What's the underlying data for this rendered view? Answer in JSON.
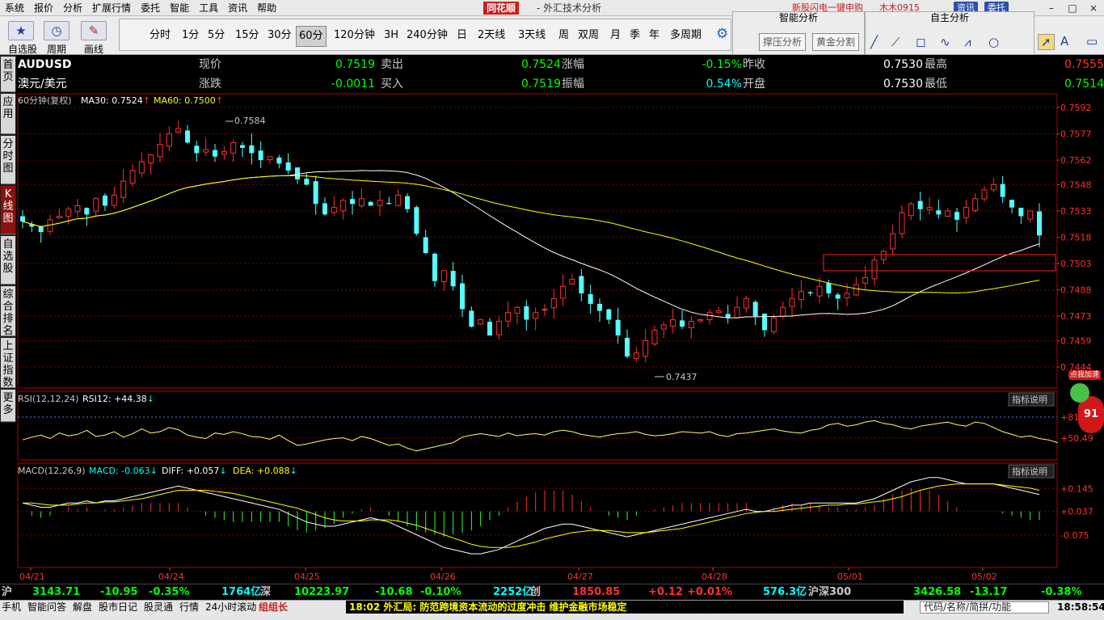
{
  "menu": {
    "items": [
      "系统",
      "报价",
      "分析",
      "扩展行情",
      "委托",
      "智能",
      "工具",
      "资讯",
      "帮助"
    ],
    "brand": "同花顺",
    "window_title": "- 外汇技术分析",
    "right_link1": "新股闪电一键申购",
    "right_link2": "木木0915",
    "btn_news": "资讯",
    "btn_trade": "委托",
    "win_min": "–",
    "win_max": "□",
    "win_close": "×"
  },
  "toolbar": {
    "zixuan": "自选股",
    "zhouqi": "周期",
    "huaxian": "画线",
    "periods": [
      "分时",
      "1分",
      "5分",
      "15分",
      "30分",
      "60分",
      "120分钟",
      "3H",
      "240分钟",
      "日",
      "2天线",
      "3天线",
      "周",
      "双周",
      "月",
      "季",
      "年",
      "多周期"
    ],
    "selected_period": "60分",
    "smart_title": "智能分析",
    "smart_btn1": "撑压分析",
    "smart_btn2": "黄金分割",
    "self_title": "自主分析"
  },
  "sidebar": [
    "首页",
    "应用",
    "分时图",
    "K线图",
    "自选股",
    "综合排名",
    "上证指数",
    "更多"
  ],
  "quote": {
    "symbol": "AUDUSD",
    "name": "澳元/美元",
    "fields": [
      {
        "label": "现价",
        "value": "0.7519",
        "color": "#00ff00"
      },
      {
        "label": "卖出",
        "value": "0.7524",
        "color": "#00ff00"
      },
      {
        "label": "涨幅",
        "value": "-0.15%",
        "color": "#00ff00"
      },
      {
        "label": "昨收",
        "value": "0.7530",
        "color": "#ffffff"
      },
      {
        "label": "最高",
        "value": "0.7555",
        "color": "#ff3030"
      },
      {
        "label": "涨跌",
        "value": "-0.0011",
        "color": "#00ff00"
      },
      {
        "label": "买入",
        "value": "0.7519",
        "color": "#00ff00"
      },
      {
        "label": "振幅",
        "value": "0.54%",
        "color": "#00ffff"
      },
      {
        "label": "开盘",
        "value": "0.7530",
        "color": "#ffffff"
      },
      {
        "label": "最低",
        "value": "0.7514",
        "color": "#00ff00"
      }
    ]
  },
  "chart_data": [
    {
      "type": "candlestick",
      "title": "60分钟(复权)",
      "indicators": [
        {
          "name": "MA30",
          "value": "0.7524",
          "arrow": "↑",
          "color": "#ffffff"
        },
        {
          "name": "MA60",
          "value": "0.7500",
          "arrow": "↑",
          "color": "#ffff00"
        }
      ],
      "ylim": [
        0.7443,
        0.7592
      ],
      "y_ticks": [
        "0.7592",
        "0.7577",
        "0.7562",
        "0.7548",
        "0.7533",
        "0.7518",
        "0.7503",
        "0.7488",
        "0.7473",
        "0.7459",
        "0.7444"
      ],
      "high_marker": "0.7584",
      "low_marker": "0.7437",
      "x_labels": [
        "04/21",
        "04/24",
        "04/25",
        "04/26",
        "04/27",
        "04/28",
        "05/01",
        "05/02"
      ],
      "close": [
        0.7527,
        0.7524,
        0.7521,
        0.7528,
        0.753,
        0.7534,
        0.7536,
        0.7531,
        0.754,
        0.7536,
        0.7542,
        0.755,
        0.7556,
        0.7561,
        0.7565,
        0.7571,
        0.7577,
        0.758,
        0.7572,
        0.7566,
        0.7568,
        0.7564,
        0.7567,
        0.7572,
        0.7569,
        0.7566,
        0.7562,
        0.7564,
        0.756,
        0.7556,
        0.7551,
        0.7548,
        0.7537,
        0.7531,
        0.7535,
        0.7539,
        0.7537,
        0.754,
        0.7536,
        0.7539,
        0.7537,
        0.7542,
        0.7534,
        0.752,
        0.7509,
        0.7493,
        0.7499,
        0.749,
        0.7477,
        0.7467,
        0.7471,
        0.7462,
        0.747,
        0.7475,
        0.7478,
        0.7471,
        0.7475,
        0.7477,
        0.7483,
        0.749,
        0.7494,
        0.7486,
        0.748,
        0.7476,
        0.7471,
        0.7462,
        0.745,
        0.7452,
        0.7459,
        0.7465,
        0.7468,
        0.7471,
        0.7467,
        0.747,
        0.7471,
        0.7475,
        0.7476,
        0.7472,
        0.7478,
        0.7483,
        0.7473,
        0.7465,
        0.7472,
        0.7478,
        0.7483,
        0.7487,
        0.7486,
        0.749,
        0.7486,
        0.7483,
        0.7486,
        0.7491,
        0.7495,
        0.7505,
        0.751,
        0.752,
        0.7532,
        0.7537,
        0.7534,
        0.7535,
        0.7531,
        0.7533,
        0.7528,
        0.7535,
        0.754,
        0.7545,
        0.7548,
        0.7541,
        0.7535,
        0.753,
        0.7533,
        0.7519
      ],
      "ma30_series_name": "MA30",
      "ma60_series_name": "MA60"
    },
    {
      "type": "line",
      "title": "RSI(12,12,24)",
      "label": "RSI12: +44.38",
      "arrow": "↓",
      "button": "指标说明",
      "ylim": [
        20,
        100
      ],
      "y_ticks": [
        "+81.12",
        "+50.49"
      ],
      "values": [
        48,
        52,
        55,
        50,
        58,
        54,
        56,
        62,
        53,
        55,
        60,
        52,
        57,
        64,
        58,
        60,
        66,
        63,
        55,
        52,
        50,
        58,
        56,
        60,
        57,
        53,
        52,
        49,
        55,
        47,
        40,
        42,
        45,
        48,
        50,
        51,
        47,
        53,
        50,
        45,
        40,
        42,
        36,
        32,
        35,
        38,
        41,
        44,
        52,
        55,
        57,
        55,
        53,
        58,
        54,
        56,
        57,
        55,
        60,
        62,
        60,
        56,
        54,
        52,
        55,
        57,
        58,
        60,
        56,
        54,
        55,
        57,
        60,
        59,
        58,
        60,
        55,
        53,
        57,
        58,
        60,
        62,
        64,
        61,
        59,
        58,
        62,
        64,
        70,
        72,
        68,
        70,
        74,
        76,
        72,
        70,
        66,
        64,
        68,
        70,
        72,
        74,
        70,
        68,
        74,
        72,
        66,
        60,
        56,
        52,
        54,
        50,
        48,
        44
      ]
    },
    {
      "type": "line",
      "title": "MACD(12,26,9)",
      "label_macd": "MACD: -0.063",
      "label_diff": "DIFF: +0.057",
      "label_dea": "DEA: +0.088",
      "arrow": "↓",
      "button": "指标说明",
      "ylim": [
        -0.22,
        0.2
      ],
      "y_ticks": [
        "+0.145",
        "+0.037",
        "-0.075"
      ],
      "diff": [
        0.04,
        0.03,
        0.02,
        0.02,
        0.03,
        0.04,
        0.04,
        0.05,
        0.04,
        0.05,
        0.05,
        0.06,
        0.07,
        0.08,
        0.09,
        0.1,
        0.11,
        0.12,
        0.11,
        0.1,
        0.09,
        0.08,
        0.07,
        0.06,
        0.05,
        0.04,
        0.03,
        0.02,
        0.01,
        -0.01,
        -0.03,
        -0.05,
        -0.06,
        -0.07,
        -0.07,
        -0.06,
        -0.05,
        -0.04,
        -0.03,
        -0.04,
        -0.05,
        -0.07,
        -0.09,
        -0.11,
        -0.13,
        -0.15,
        -0.17,
        -0.18,
        -0.19,
        -0.2,
        -0.2,
        -0.19,
        -0.18,
        -0.16,
        -0.14,
        -0.12,
        -0.1,
        -0.08,
        -0.07,
        -0.06,
        -0.06,
        -0.07,
        -0.08,
        -0.09,
        -0.1,
        -0.11,
        -0.12,
        -0.11,
        -0.1,
        -0.09,
        -0.08,
        -0.07,
        -0.06,
        -0.05,
        -0.04,
        -0.03,
        -0.02,
        -0.01,
        0.0,
        0.01,
        0.0,
        0.0,
        0.01,
        0.02,
        0.03,
        0.03,
        0.04,
        0.04,
        0.04,
        0.04,
        0.04,
        0.04,
        0.05,
        0.06,
        0.08,
        0.1,
        0.12,
        0.14,
        0.15,
        0.16,
        0.16,
        0.15,
        0.14,
        0.13,
        0.13,
        0.13,
        0.13,
        0.12,
        0.11,
        0.1,
        0.09,
        0.08
      ],
      "dea": [
        0.04,
        0.04,
        0.035,
        0.03,
        0.03,
        0.03,
        0.035,
        0.04,
        0.04,
        0.045,
        0.045,
        0.05,
        0.055,
        0.06,
        0.07,
        0.08,
        0.09,
        0.1,
        0.1,
        0.1,
        0.1,
        0.095,
        0.09,
        0.085,
        0.075,
        0.065,
        0.055,
        0.045,
        0.035,
        0.025,
        0.015,
        0.0,
        -0.015,
        -0.03,
        -0.04,
        -0.045,
        -0.045,
        -0.045,
        -0.04,
        -0.04,
        -0.04,
        -0.045,
        -0.055,
        -0.065,
        -0.08,
        -0.095,
        -0.11,
        -0.125,
        -0.14,
        -0.155,
        -0.165,
        -0.17,
        -0.17,
        -0.17,
        -0.165,
        -0.155,
        -0.145,
        -0.13,
        -0.12,
        -0.11,
        -0.1,
        -0.095,
        -0.09,
        -0.09,
        -0.09,
        -0.095,
        -0.1,
        -0.1,
        -0.1,
        -0.095,
        -0.09,
        -0.085,
        -0.08,
        -0.07,
        -0.06,
        -0.05,
        -0.04,
        -0.03,
        -0.02,
        -0.01,
        -0.005,
        0.0,
        0.0,
        0.005,
        0.01,
        0.015,
        0.02,
        0.025,
        0.03,
        0.03,
        0.035,
        0.035,
        0.04,
        0.045,
        0.05,
        0.06,
        0.07,
        0.085,
        0.1,
        0.11,
        0.12,
        0.125,
        0.13,
        0.13,
        0.13,
        0.13,
        0.13,
        0.125,
        0.12,
        0.115,
        0.11,
        0.1
      ]
    }
  ],
  "status": {
    "sh_label": "沪",
    "sh_price": "3143.71",
    "sh_chg": "-10.95",
    "sh_pct": "-0.35%",
    "sh_vol": "1764亿",
    "sz_label": "深",
    "sz_price": "10223.97",
    "sz_chg": "-10.68",
    "sz_pct": "-0.10%",
    "sz_vol": "2252亿",
    "cy_label": "创",
    "cy_price": "1850.85",
    "cy_chg": "+0.12",
    "cy_pct": "+0.01%",
    "cy_vol": "576.3亿",
    "hs_label": "沪深300",
    "hs_price": "3426.58",
    "hs_chg": "-13.17",
    "hs_pct": "-0.38%"
  },
  "taskbar": {
    "items": [
      "手机",
      "智能问答",
      "解盘",
      "股市日记",
      "股灵通",
      "行情",
      "24小时滚动",
      "组组长"
    ],
    "news": "18:02 外汇局: 防范跨境资本流动的过度冲击 维护金融市场稳定",
    "search_placeholder": "代码/名称/简拼/功能",
    "clock": "18:58:54"
  },
  "addbtn_label": "点我加速",
  "addbtn_num": "91"
}
